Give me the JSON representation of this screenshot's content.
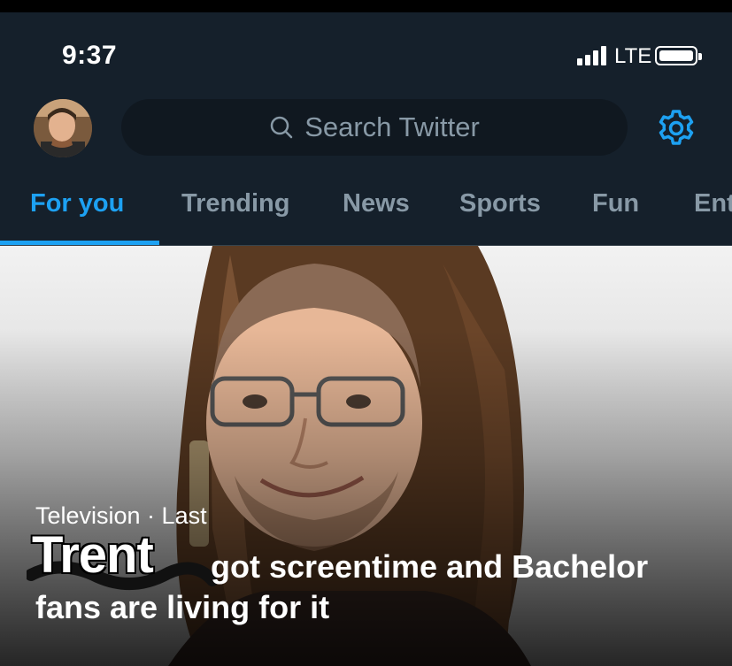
{
  "status": {
    "time": "9:37",
    "carrier": "LTE"
  },
  "header": {
    "search_placeholder": "Search Twitter"
  },
  "tabs": [
    {
      "label": "For you",
      "active": true
    },
    {
      "label": "Trending",
      "active": false
    },
    {
      "label": "News",
      "active": false
    },
    {
      "label": "Sports",
      "active": false
    },
    {
      "label": "Fun",
      "active": false
    },
    {
      "label": "Ent",
      "active": false
    }
  ],
  "hero": {
    "meta": "Television · Last",
    "overlay_name": "Trent",
    "title": "got screentime and Bachelor fans are living for it"
  },
  "colors": {
    "background": "#15202b",
    "accent": "#1da1f2",
    "muted": "#8899a6",
    "search_bg": "#101820"
  },
  "icons": {
    "search": "search-icon",
    "settings": "gear-icon",
    "signal": "signal-icon",
    "battery": "battery-icon"
  }
}
